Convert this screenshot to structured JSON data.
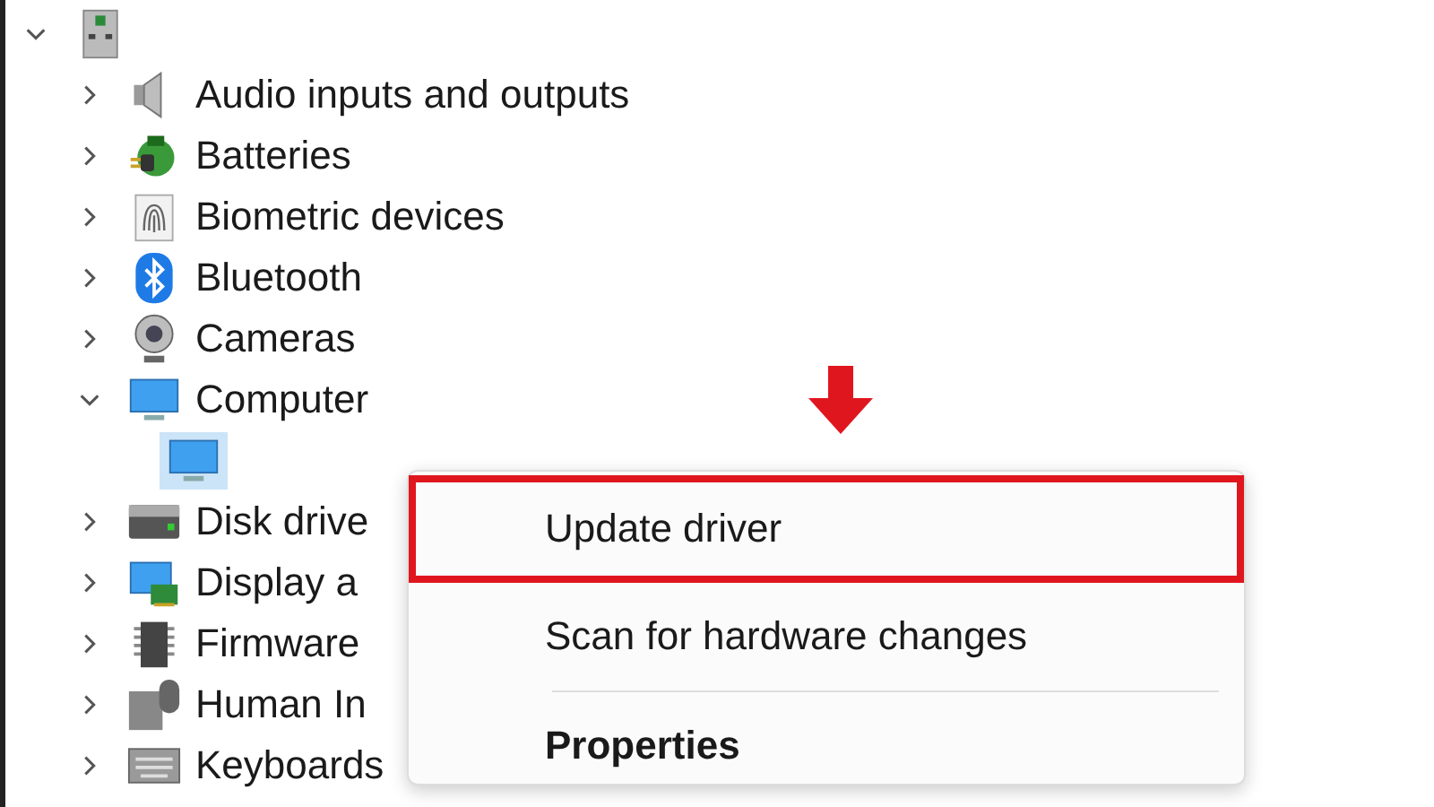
{
  "tree": {
    "expanded": true,
    "children": [
      {
        "label": "Audio inputs and outputs",
        "expanded": false
      },
      {
        "label": "Batteries",
        "expanded": false
      },
      {
        "label": "Biometric devices",
        "expanded": false
      },
      {
        "label": "Bluetooth",
        "expanded": false
      },
      {
        "label": "Cameras",
        "expanded": false
      },
      {
        "label": "Computer",
        "expanded": true,
        "children": [
          {
            "selected": true
          }
        ]
      },
      {
        "label": "Disk drive",
        "expanded": false
      },
      {
        "label": "Display a",
        "expanded": false
      },
      {
        "label": "Firmware",
        "expanded": false
      },
      {
        "label": "Human In",
        "expanded": false
      },
      {
        "label": "Keyboards",
        "expanded": false
      }
    ]
  },
  "context_menu": {
    "items": [
      {
        "label": "Update driver",
        "highlighted": true,
        "bold": false
      },
      {
        "label": "Scan for hardware changes",
        "highlighted": false,
        "bold": false
      },
      {
        "label": "Properties",
        "highlighted": false,
        "bold": true
      }
    ]
  }
}
